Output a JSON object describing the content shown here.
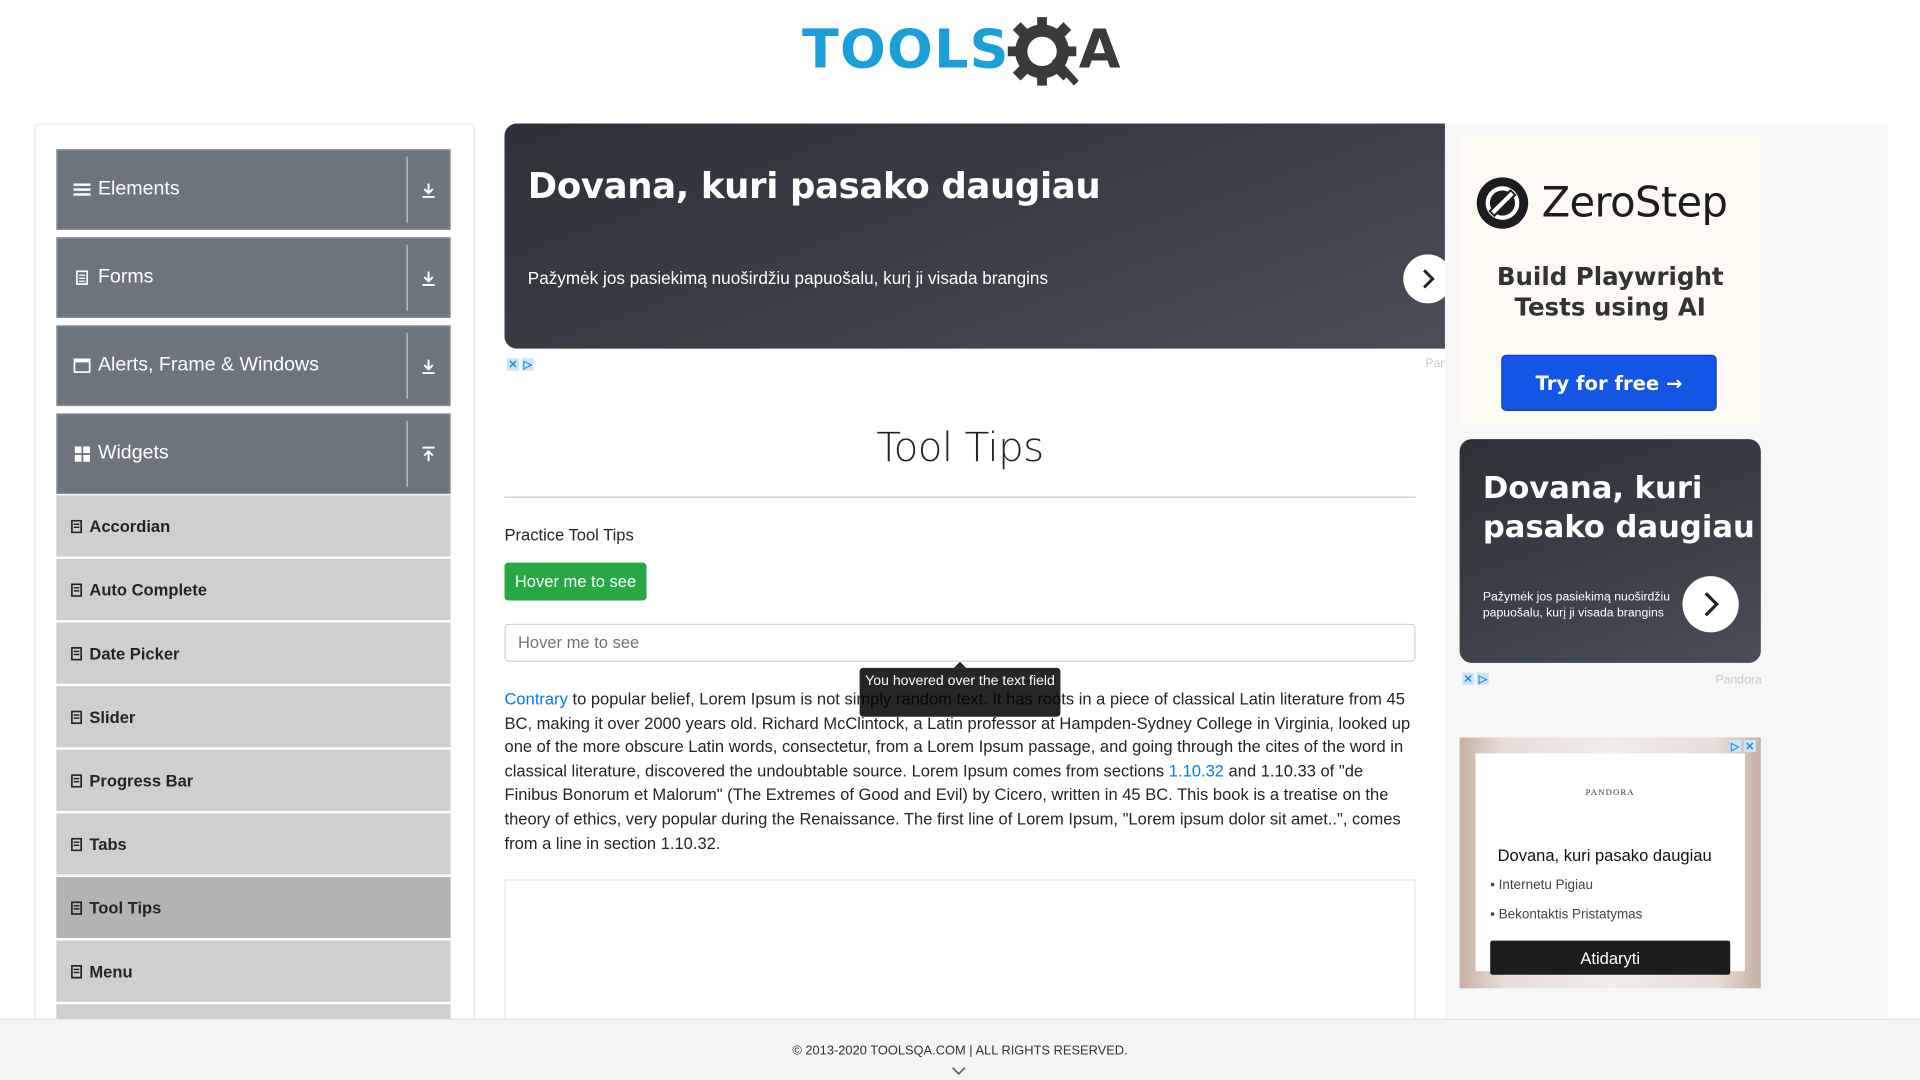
{
  "header": {
    "logo_text": "TOOLS",
    "logo_accent": "A"
  },
  "sidebar": {
    "groups": [
      {
        "label": "Elements",
        "icon": "menu-lines-icon",
        "state": "collapsed"
      },
      {
        "label": "Forms",
        "icon": "document-icon",
        "state": "collapsed"
      },
      {
        "label": "Alerts, Frame & Windows",
        "icon": "window-icon",
        "state": "collapsed"
      },
      {
        "label": "Widgets",
        "icon": "grid-icon",
        "state": "expanded"
      }
    ],
    "items": [
      {
        "label": "Accordian"
      },
      {
        "label": "Auto Complete"
      },
      {
        "label": "Date Picker"
      },
      {
        "label": "Slider"
      },
      {
        "label": "Progress Bar"
      },
      {
        "label": "Tabs"
      },
      {
        "label": "Tool Tips"
      },
      {
        "label": "Menu"
      }
    ],
    "active_item": "Tool Tips"
  },
  "ad_top": {
    "title": "Dovana, kuri pasako daugiau",
    "text": "Pažymėk jos pasiekimą nuoširdžiu papuošalu, kurį ji visada brangins",
    "source": "Pan"
  },
  "main": {
    "title": "Tool Tips",
    "practice_label": "Practice Tool Tips",
    "hover_button_label": "Hover me to see",
    "hover_input_placeholder": "Hover me to see",
    "tooltip_text": "You hovered over the text field",
    "para": {
      "link1": "Contrary",
      "part1": " to popular belief, Lorem Ipsum is not simply random text. It has roots in a piece of classical Latin literature from 45 BC, making it over 2000 years old. Richard McClintock, a Latin professor at Hampden-Sydney College in Virginia, looked up one of the more obscure Latin words, consectetur, from a Lorem Ipsum passage, and going through the cites of the word in classical literature, discovered the undoubtable source. Lorem Ipsum comes from sections ",
      "link2": "1.10.32",
      "part2": " and 1.10.33 of \"de Finibus Bonorum et Malorum\" (The Extremes of Good and Evil) by Cicero, written in 45 BC. This book is a treatise on the theory of ethics, very popular during the Renaissance. The first line of Lorem Ipsum, \"Lorem ipsum dolor sit amet..\", comes from a line in section 1.10.32."
    }
  },
  "ads_right": {
    "zerostep": {
      "name": "ZeroStep",
      "tagline": "Build Playwright Tests using AI",
      "button": "Try for free →"
    },
    "dovana": {
      "title": "Dovana, kuri pasako daugiau",
      "text": "Pažymėk jos pasiekimą nuoširdžiu papuošalu, kurį ji visada brangins",
      "source": "Pandora"
    },
    "pandora": {
      "brand": "PANDORA",
      "title": "Dovana, kuri pasako daugiau",
      "bullet1": "• Internetu Pigiau",
      "bullet2": "• Bekontaktis Pristatymas",
      "button": "Atidaryti"
    }
  },
  "footer": {
    "text": "© 2013-2020 TOOLSQA.COM | ALL RIGHTS RESERVED."
  },
  "colors": {
    "brand_blue": "#1b9fd9",
    "sidebar_group": "#6c757d",
    "sidebar_item": "#cfcfcf",
    "success_green": "#28a745",
    "link_blue": "#007bff",
    "zerostep_blue": "#1455e6"
  }
}
